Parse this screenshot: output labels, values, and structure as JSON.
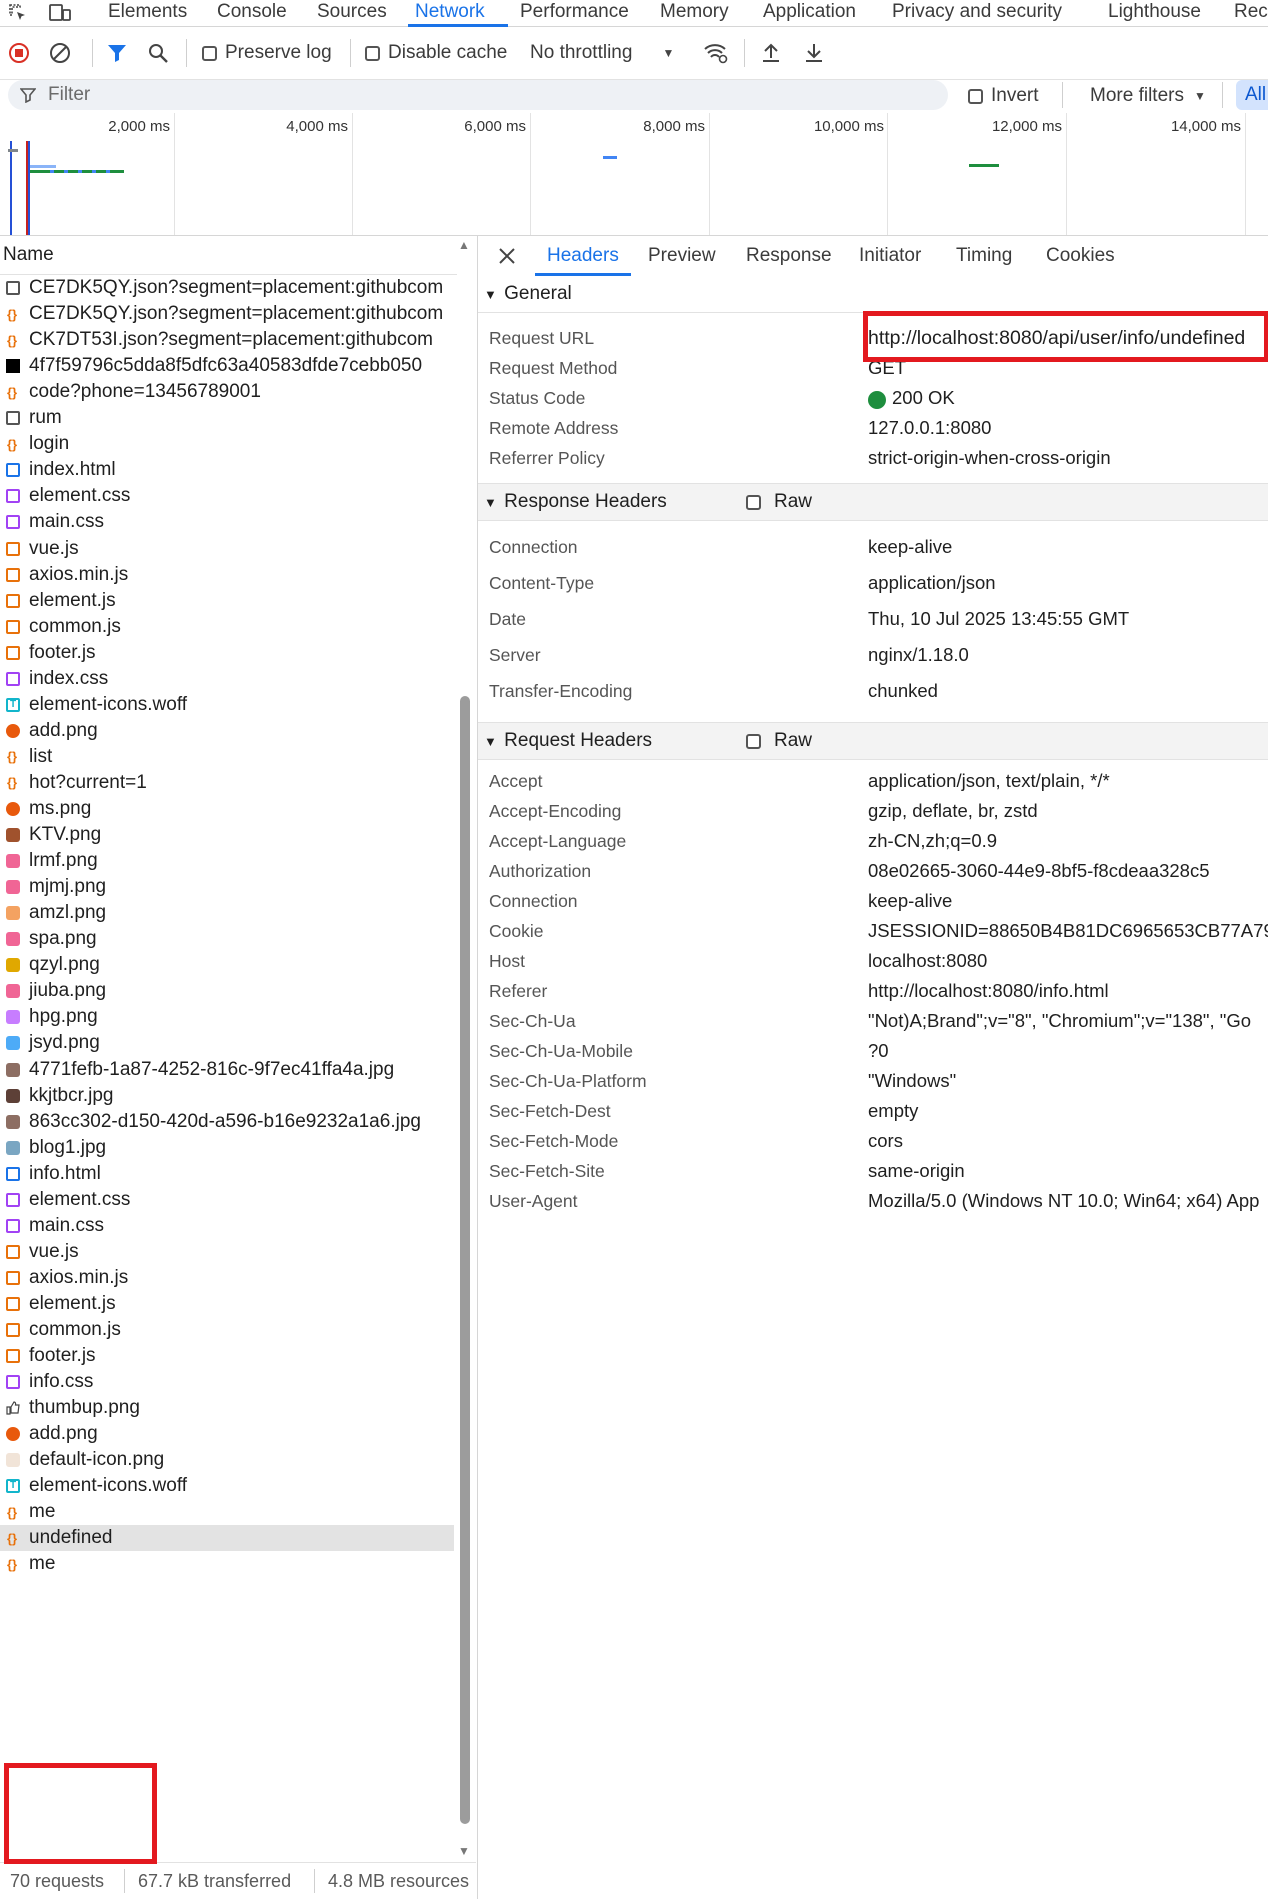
{
  "tabs": [
    "Elements",
    "Console",
    "Sources",
    "Network",
    "Performance",
    "Memory",
    "Application",
    "Privacy and security",
    "Lighthouse",
    "Rec"
  ],
  "active_tab": "Network",
  "toolbar": {
    "preserve_log": "Preserve log",
    "disable_cache": "Disable cache",
    "throttling": "No throttling"
  },
  "filter": {
    "placeholder": "Filter",
    "invert": "Invert",
    "more_filters": "More filters",
    "all": "All"
  },
  "timeline": {
    "labels": [
      "2,000 ms",
      "4,000 ms",
      "6,000 ms",
      "8,000 ms",
      "10,000 ms",
      "12,000 ms",
      "14,000 ms"
    ]
  },
  "requests": {
    "column": "Name",
    "rows": [
      {
        "name": "CE7DK5QY.json?segment=placement:githubcom",
        "type": "other"
      },
      {
        "name": "CE7DK5QY.json?segment=placement:githubcom",
        "type": "xhr"
      },
      {
        "name": "CK7DT53I.json?segment=placement:githubcom",
        "type": "xhr"
      },
      {
        "name": "4f7f59796c5dda8f5dfc63a40583dfde7cebb050",
        "type": "black"
      },
      {
        "name": "code?phone=13456789001",
        "type": "xhr"
      },
      {
        "name": "rum",
        "type": "other"
      },
      {
        "name": "login",
        "type": "xhr"
      },
      {
        "name": "index.html",
        "type": "doc"
      },
      {
        "name": "element.css",
        "type": "css"
      },
      {
        "name": "main.css",
        "type": "css"
      },
      {
        "name": "vue.js",
        "type": "js"
      },
      {
        "name": "axios.min.js",
        "type": "js"
      },
      {
        "name": "element.js",
        "type": "js"
      },
      {
        "name": "common.js",
        "type": "js"
      },
      {
        "name": "footer.js",
        "type": "js"
      },
      {
        "name": "index.css",
        "type": "css"
      },
      {
        "name": "element-icons.woff",
        "type": "font"
      },
      {
        "name": "add.png",
        "type": "img-orange"
      },
      {
        "name": "list",
        "type": "xhr"
      },
      {
        "name": "hot?current=1",
        "type": "xhr"
      },
      {
        "name": "ms.png",
        "type": "img-orange"
      },
      {
        "name": "KTV.png",
        "type": "img-brown"
      },
      {
        "name": "lrmf.png",
        "type": "img-pink"
      },
      {
        "name": "mjmj.png",
        "type": "img-pink"
      },
      {
        "name": "amzl.png",
        "type": "img-peach"
      },
      {
        "name": "spa.png",
        "type": "img-pink"
      },
      {
        "name": "qzyl.png",
        "type": "img-gold"
      },
      {
        "name": "jiuba.png",
        "type": "img-pink"
      },
      {
        "name": "hpg.png",
        "type": "img-violet"
      },
      {
        "name": "jsyd.png",
        "type": "img-blue"
      },
      {
        "name": "4771fefb-1a87-4252-816c-9f7ec41ffa4a.jpg",
        "type": "img-photo"
      },
      {
        "name": "kkjtbcr.jpg",
        "type": "img-photo2"
      },
      {
        "name": "863cc302-d150-420d-a596-b16e9232a1a6.jpg",
        "type": "img-photo"
      },
      {
        "name": "blog1.jpg",
        "type": "img-photo3"
      },
      {
        "name": "info.html",
        "type": "doc"
      },
      {
        "name": "element.css",
        "type": "css"
      },
      {
        "name": "main.css",
        "type": "css"
      },
      {
        "name": "vue.js",
        "type": "js"
      },
      {
        "name": "axios.min.js",
        "type": "js"
      },
      {
        "name": "element.js",
        "type": "js"
      },
      {
        "name": "common.js",
        "type": "js"
      },
      {
        "name": "footer.js",
        "type": "js"
      },
      {
        "name": "info.css",
        "type": "css"
      },
      {
        "name": "thumbup.png",
        "type": "thumb"
      },
      {
        "name": "add.png",
        "type": "img-orange"
      },
      {
        "name": "default-icon.png",
        "type": "img-light"
      },
      {
        "name": "element-icons.woff",
        "type": "font"
      },
      {
        "name": "me",
        "type": "xhr"
      },
      {
        "name": "undefined",
        "type": "xhr"
      },
      {
        "name": "me",
        "type": "xhr"
      }
    ],
    "selected": "undefined"
  },
  "status": {
    "requests": "70 requests",
    "transferred": "67.7 kB transferred",
    "resources": "4.8 MB resources"
  },
  "details": {
    "tabs": [
      "Headers",
      "Preview",
      "Response",
      "Initiator",
      "Timing",
      "Cookies"
    ],
    "active_tab": "Headers",
    "general": {
      "title": "General",
      "rows": [
        {
          "key": "Request URL",
          "value": "http://localhost:8080/api/user/info/undefined"
        },
        {
          "key": "Request Method",
          "value": "GET"
        },
        {
          "key": "Status Code",
          "value": "200 OK"
        },
        {
          "key": "Remote Address",
          "value": "127.0.0.1:8080"
        },
        {
          "key": "Referrer Policy",
          "value": "strict-origin-when-cross-origin"
        }
      ]
    },
    "response_headers": {
      "title": "Response Headers",
      "raw": "Raw",
      "rows": [
        {
          "key": "Connection",
          "value": "keep-alive"
        },
        {
          "key": "Content-Type",
          "value": "application/json"
        },
        {
          "key": "Date",
          "value": "Thu, 10 Jul 2025 13:45:55 GMT"
        },
        {
          "key": "Server",
          "value": "nginx/1.18.0"
        },
        {
          "key": "Transfer-Encoding",
          "value": "chunked"
        }
      ]
    },
    "request_headers": {
      "title": "Request Headers",
      "raw": "Raw",
      "rows": [
        {
          "key": "Accept",
          "value": "application/json, text/plain, */*"
        },
        {
          "key": "Accept-Encoding",
          "value": "gzip, deflate, br, zstd"
        },
        {
          "key": "Accept-Language",
          "value": "zh-CN,zh;q=0.9"
        },
        {
          "key": "Authorization",
          "value": "08e02665-3060-44e9-8bf5-f8cdeaa328c5"
        },
        {
          "key": "Connection",
          "value": "keep-alive"
        },
        {
          "key": "Cookie",
          "value": "JSESSIONID=88650B4B81DC6965653CB77A79"
        },
        {
          "key": "Host",
          "value": "localhost:8080"
        },
        {
          "key": "Referer",
          "value": "http://localhost:8080/info.html"
        },
        {
          "key": "Sec-Ch-Ua",
          "value": "\"Not)A;Brand\";v=\"8\", \"Chromium\";v=\"138\", \"Go"
        },
        {
          "key": "Sec-Ch-Ua-Mobile",
          "value": "?0"
        },
        {
          "key": "Sec-Ch-Ua-Platform",
          "value": "\"Windows\""
        },
        {
          "key": "Sec-Fetch-Dest",
          "value": "empty"
        },
        {
          "key": "Sec-Fetch-Mode",
          "value": "cors"
        },
        {
          "key": "Sec-Fetch-Site",
          "value": "same-origin"
        },
        {
          "key": "User-Agent",
          "value": "Mozilla/5.0 (Windows NT 10.0; Win64; x64) App"
        }
      ]
    }
  },
  "colors": {
    "accent": "#1a73e8",
    "highlight": "#e3191f",
    "status_ok": "#1e8e3e"
  }
}
